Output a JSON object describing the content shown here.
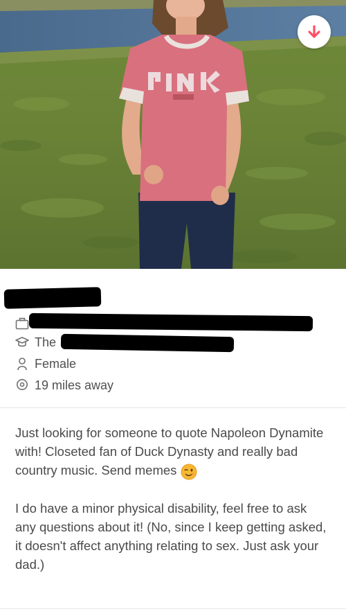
{
  "profile": {
    "photo_alt": "",
    "collapse_icon": "arrow-down-icon",
    "accent_color": "#fd5068",
    "details": {
      "school_prefix": "The",
      "gender": "Female",
      "distance": "19 miles away"
    },
    "bio": {
      "paragraph1": "Just looking for someone to quote Napoleon Dynamite with! Closeted fan of Duck Dynasty and really bad country music. Send memes",
      "paragraph1_emoji": "winking-face-emoji",
      "paragraph2": "I do have a minor physical disability, feel free to ask any questions about it! (No, since I keep getting asked, it doesn't affect anything relating to sex. Just ask your dad.)"
    }
  }
}
